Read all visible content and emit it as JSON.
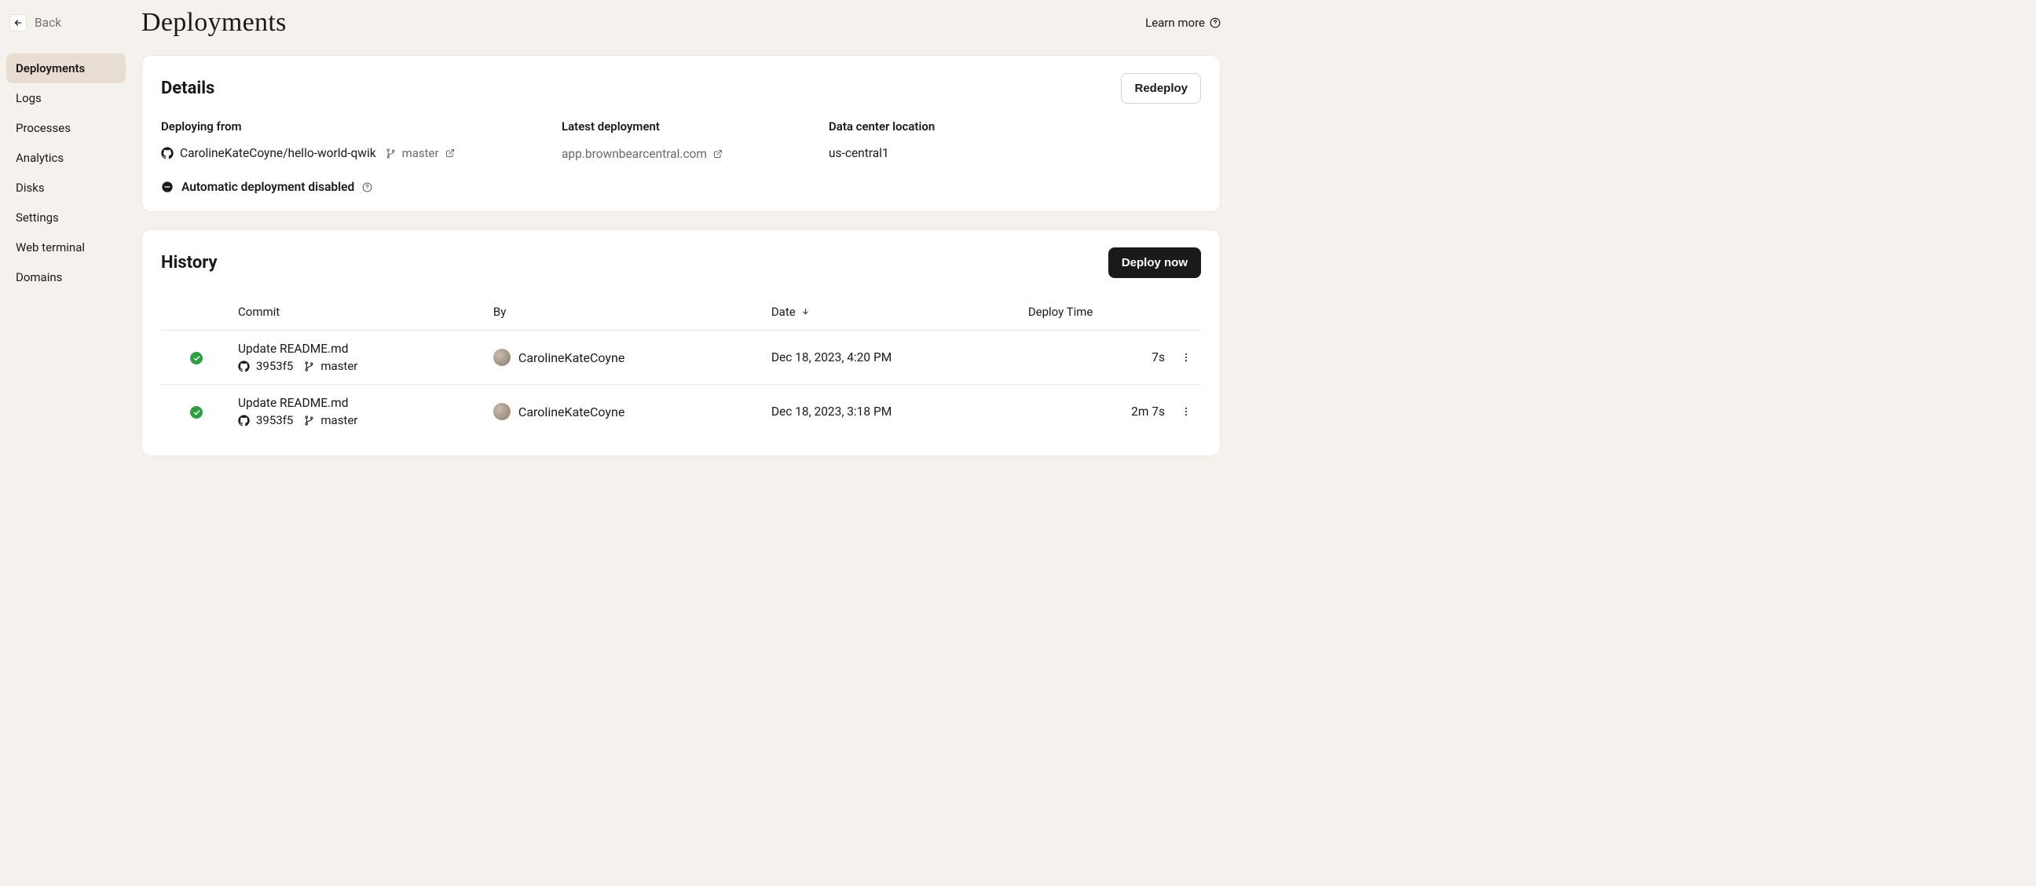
{
  "back": {
    "label": "Back"
  },
  "sidebar": {
    "items": [
      {
        "label": "Deployments",
        "active": true
      },
      {
        "label": "Logs",
        "active": false
      },
      {
        "label": "Processes",
        "active": false
      },
      {
        "label": "Analytics",
        "active": false
      },
      {
        "label": "Disks",
        "active": false
      },
      {
        "label": "Settings",
        "active": false
      },
      {
        "label": "Web terminal",
        "active": false
      },
      {
        "label": "Domains",
        "active": false
      }
    ]
  },
  "page": {
    "title": "Deployments",
    "learn_more": "Learn more"
  },
  "details": {
    "title": "Details",
    "redeploy_label": "Redeploy",
    "deploying_from_label": "Deploying from",
    "repo": "CarolineKateCoyne/hello-world-qwik",
    "branch": "master",
    "latest_deployment_label": "Latest deployment",
    "deployment_url": "app.brownbearcentral.com",
    "data_center_label": "Data center location",
    "data_center": "us-central1",
    "auto_deploy_label": "Automatic deployment disabled"
  },
  "history": {
    "title": "History",
    "deploy_now_label": "Deploy now",
    "columns": {
      "commit": "Commit",
      "by": "By",
      "date": "Date",
      "deploy_time": "Deploy Time"
    },
    "sort_direction": "down",
    "rows": [
      {
        "status": "success",
        "message": "Update README.md",
        "sha": "3953f5",
        "branch": "master",
        "by": "CarolineKateCoyne",
        "date": "Dec 18, 2023, 4:20 PM",
        "deploy_time": "7s"
      },
      {
        "status": "success",
        "message": "Update README.md",
        "sha": "3953f5",
        "branch": "master",
        "by": "CarolineKateCoyne",
        "date": "Dec 18, 2023, 3:18 PM",
        "deploy_time": "2m 7s"
      }
    ]
  }
}
